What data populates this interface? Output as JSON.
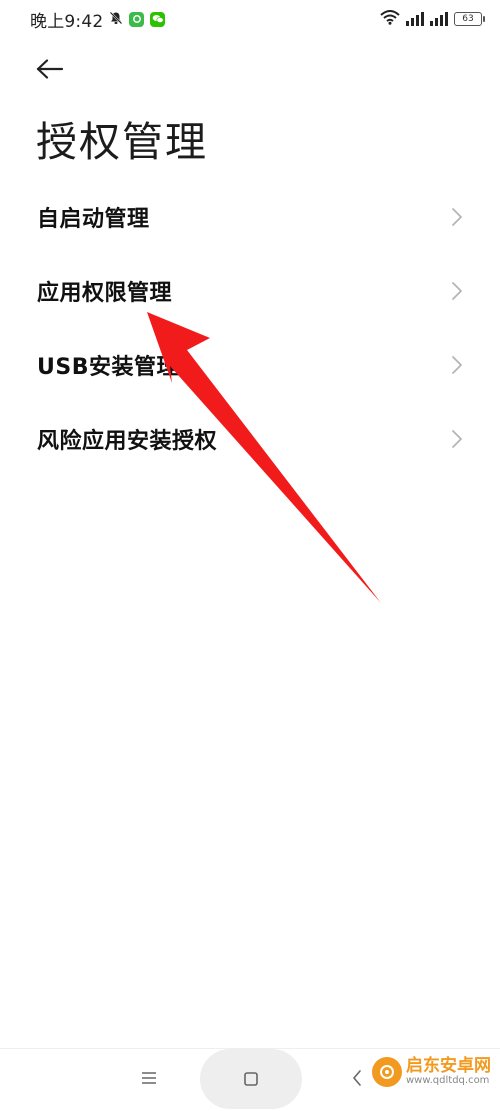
{
  "status_bar": {
    "time": "晚上9:42",
    "battery": "63"
  },
  "page": {
    "title": "授权管理"
  },
  "menu": {
    "items": [
      {
        "label": "自启动管理"
      },
      {
        "label": "应用权限管理"
      },
      {
        "label": "USB安装管理"
      },
      {
        "label": "风险应用安装授权"
      }
    ]
  },
  "watermark": {
    "title": "启东安卓网",
    "url": "www.qdltdq.com"
  },
  "colors": {
    "arrow": "#f21b1b",
    "watermark": "#f29a1f",
    "wechat": "#2dc100",
    "app_green": "#3dbb4a"
  },
  "icons": {
    "back": "arrow-left-icon",
    "chevron": "chevron-right-icon",
    "nav_menu": "menu-lines-icon",
    "nav_home": "square-icon",
    "nav_back": "chevron-left-icon"
  }
}
